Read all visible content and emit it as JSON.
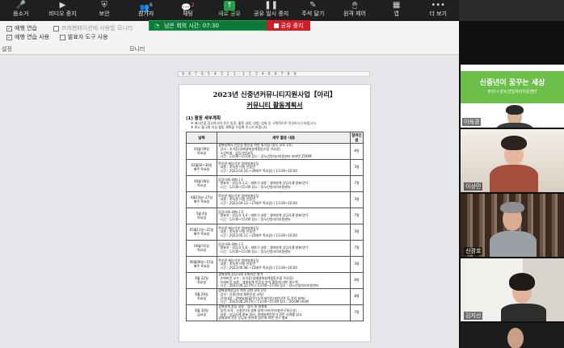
{
  "toolbar": {
    "buttons": [
      {
        "label": "음소거",
        "icon": "microphone-icon"
      },
      {
        "label": "비디오 중지",
        "icon": "video-camera-icon"
      },
      {
        "label": "보안",
        "icon": "shield-icon"
      },
      {
        "label": "참가자",
        "icon": "participants-icon"
      },
      {
        "label": "채팅",
        "icon": "chat-icon"
      },
      {
        "label": "새로 공유",
        "icon": "share-screen-icon"
      },
      {
        "label": "공유 일시 중지",
        "icon": "pause-icon"
      },
      {
        "label": "주석 달기",
        "icon": "annotate-icon"
      },
      {
        "label": "원격 제어",
        "icon": "remote-control-icon"
      },
      {
        "label": "앱",
        "icon": "apps-icon"
      },
      {
        "label": "더 보기",
        "icon": "more-icon"
      }
    ],
    "participants_count": "6",
    "chat_count": "2"
  },
  "timer": {
    "label": "남은 회의 시간: 07:30"
  },
  "stop_share": {
    "label": "공유 중지"
  },
  "ribbon": {
    "presenter_view_label": "프레젠테이션에 사용할 모니터",
    "rehearse_label": "예행 연습",
    "rehearse_use_label": "예행 연습 사용",
    "presenter_tools_label": "발표자 도구 사용",
    "group_left": "설정",
    "group_monitor": "모니터"
  },
  "ruler": {
    "ticks": "9 · 8 · 7 · 6 · 5 · 4 · 3 · 2 · 1 · · 1 · 2 · 3 · 4 · 5 · 6 · 7 · 8 · 9"
  },
  "document": {
    "title": "2023년 신중년커뮤니티지원사업【아리】",
    "subtitle": "커뮤니티 활동계획서",
    "section": "(1) 활동 세부계획",
    "notes": [
      "※ 예시문을 참고하시며 추진 일정, 활동 내용, 방법, 범위 등 구체적으로 작성하시기 바랍니다.",
      "※ 최소 월 2회 이상 활동 계획을 수립해 주시기 바랍니다."
    ],
    "columns": [
      "날짜",
      "세부 활동 내용",
      "참여인원"
    ],
    "rows": [
      {
        "date": "03월 09일\n목요일",
        "content": "생애설계사 전문성 향상을 위한 워크샵 (실무 교육 1차)\n · 강사 : 조기훈(경제생애설계협동조합 이사장)\n · 노인미래 : 삼담기법교육\n · 시간 : 13:00~15:00   장소 : 장노년일자리지원센터 비대면 ZOOM",
        "cnt": "8명"
      },
      {
        "date": "03월16~30일\n매주 목요일",
        "content": "목지관 재능기부 생애설계상담\n · 내용 : 목지관 이용 신중년\n · 시간 : 2023.03.16.~30매주 목요일) / 13:00~16:00",
        "cnt": "3명"
      },
      {
        "date": "04월 06일\n목요일",
        "content": "상담사례 세미나 1\n · 발표자 : 상담사 1,2  - 세미나 내용 : 생애설계 상담사례 발표/연구\n · 시간 : 13:00~15:00   장소 : 장노년일자리지원센터",
        "cnt": "7명"
      },
      {
        "date": "4월13일~27일\n매주 목요일",
        "content": "목지관 재능기부 생애설계상담\n · 내용 : 목지관 이용 신중년\n · 시간 : 2023.04.13.~27매주 목요일) / 13:00~16:00",
        "cnt": "3명"
      },
      {
        "date": "5월 4일\n목요일",
        "content": "상담사례 세미나 2\n · 발표자 : 상담사 3,4  - 세미나 내용 : 생애설계 상담사례 발표/연구\n · 시간 : 13:00~15:00   장소 : 장노년일자리지원센터",
        "cnt": "7명"
      },
      {
        "date": "05월11일~25일\n매주 목요일",
        "content": "목지관 재능기부 생애설계상담\n · 내용 : 목지관 이용 신중년\n · 시간 : 2023.05.11.~25매주 목요일) / 13:00~16:00",
        "cnt": "3명"
      },
      {
        "date": "06월 01일\n목요일",
        "content": "상담사례 세미나 3\n · 발표자 : 상담사 5,6  - 세미나 내용 : 생애설계 상담사례 발표/연구\n · 시간 : 13:00~15:00   장소 : 장노년일자리지원센터",
        "cnt": "7명"
      },
      {
        "date": "06월08일~15일\n매주 목요일",
        "content": "목지관 재능기부 생애설계상담\n · 내용 : 목지관 이용 신중년\n · 시간 : 2023.06.08.~15매주 목요일) / 13:00~16:00",
        "cnt": "3명"
      },
      {
        "date": "6월 22일\n목요일",
        "content": "생애설계 상담사례 슈퍼비전 발거\n · 슈퍼비전 교수 : 조기훈(경제생애설계협동조합 이사장)\n · 슈퍼비전 내용 : 생애설계 전문성 분석 활동에 대한 피드백\n · 시간 : 2023.06.22.(목) / 13:00~15:00   장소 : 장노년일자리지원센터",
        "cnt": "8명"
      },
      {
        "date": "6월 29일\n목요일",
        "content": "생애설계상담사 역량 강화 교육 2차\n · 강사 : 신중년(대 재취준생 교육)\n · 강의내용 : 생애설계(활/주인)/주세안전(개인안전 등 목적 설계)\n · 시간 : 2023.06.29.(목) / 13:00~15:00   장소 : ZOOM 비대면",
        "cnt": "8명"
      },
      {
        "date": "6월 30일\n금요일",
        "content": "생애설계 종합 내용 : 정리 완 발표회\n · 참석 자격 : 신중년(대 생애 설계 아카이브/총연구회구성)\n · 내용 : 상담사례 발표 정리, 생애설계전문가 전문 사례를 읽고\n   생애설계 전문 상담과 관련해 방안에 대한 연구 발표",
        "cnt": "7명"
      }
    ]
  },
  "gallery": {
    "banner": {
      "line1": "신중년이 꿈꾸는 세상",
      "line2": "부산시 장노년일자리지원센터"
    },
    "participants": [
      {
        "name": "이육경"
      },
      {
        "name": "이상민"
      },
      {
        "name": "신경호"
      },
      {
        "name": "김지선"
      }
    ]
  }
}
